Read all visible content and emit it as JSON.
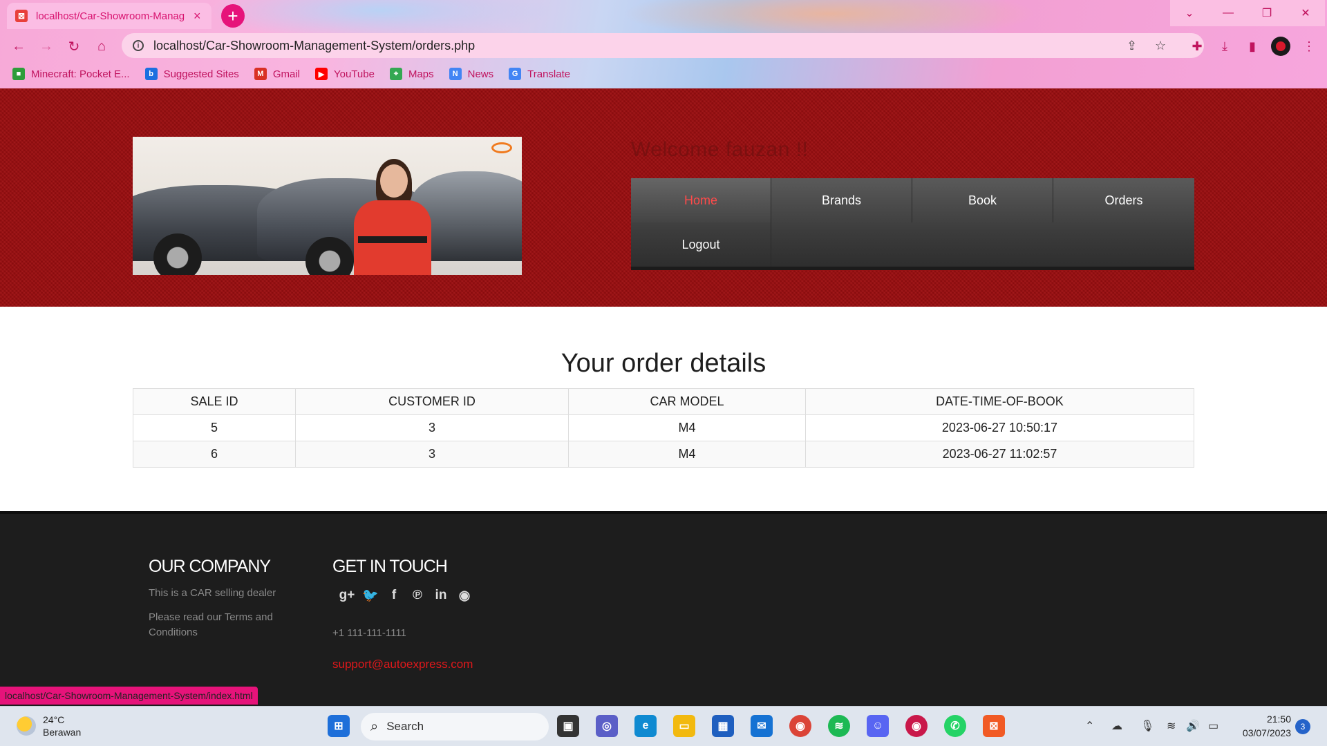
{
  "browser": {
    "tab_title": "localhost/Car-Showroom-Manag",
    "tab_close": "×",
    "new_tab": "+",
    "url": "localhost/Car-Showroom-Management-System/orders.php",
    "window_controls": [
      "⌄",
      "—",
      "❐",
      "✕"
    ],
    "bookmarks": [
      {
        "label": "Minecraft: Pocket E...",
        "color": "#2e9d3a",
        "icon": "minecraft-icon"
      },
      {
        "label": "Suggested Sites",
        "color": "#1c6fe0",
        "icon": "bing-icon"
      },
      {
        "label": "Gmail",
        "color": "#d93025",
        "icon": "gmail-icon"
      },
      {
        "label": "YouTube",
        "color": "#ff0000",
        "icon": "youtube-icon"
      },
      {
        "label": "Maps",
        "color": "#34a853",
        "icon": "maps-icon"
      },
      {
        "label": "News",
        "color": "#4285f4",
        "icon": "news-icon"
      },
      {
        "label": "Translate",
        "color": "#4285f4",
        "icon": "translate-icon"
      }
    ],
    "status_url": "localhost/Car-Showroom-Management-System/index.html"
  },
  "header": {
    "welcome": "Welcome fauzan !!",
    "nav": [
      {
        "label": "Home",
        "active": true
      },
      {
        "label": "Brands",
        "active": false
      },
      {
        "label": "Book",
        "active": false
      },
      {
        "label": "Orders",
        "active": false
      },
      {
        "label": "Logout",
        "active": false
      }
    ]
  },
  "orders": {
    "title": "Your order details",
    "columns": [
      "SALE ID",
      "CUSTOMER ID",
      "CAR MODEL",
      "DATE-TIME-OF-BOOK"
    ],
    "rows": [
      [
        "5",
        "3",
        "M4",
        "2023-06-27 10:50:17"
      ],
      [
        "6",
        "3",
        "M4",
        "2023-06-27 11:02:57"
      ]
    ]
  },
  "footer": {
    "company_title": "OUR COMPANY",
    "company_text1": "This is a CAR selling dealer",
    "company_text2_line1": "Please read our Terms and",
    "company_text2_line2": "Conditions",
    "contact_title": "GET IN TOUCH",
    "social": [
      "g+",
      "🐦",
      "f",
      "℗",
      "in",
      "◉"
    ],
    "phone": "+1 111-111-1111",
    "email": "support@autoexpress.com",
    "accent": "#e0181b"
  },
  "taskbar": {
    "temperature": "24°C",
    "weather": "Berawan",
    "search_placeholder": "Search",
    "time": "21:50",
    "date": "03/07/2023",
    "notifications": "3"
  }
}
